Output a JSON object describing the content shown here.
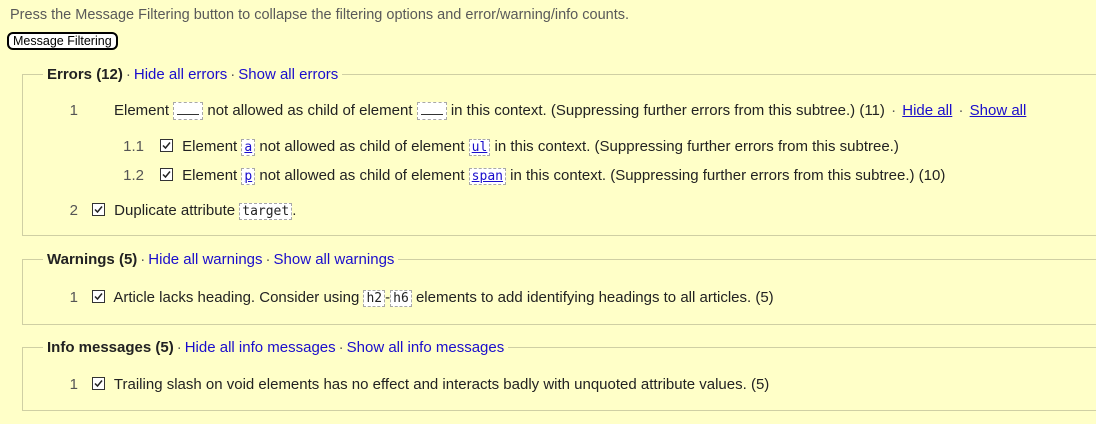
{
  "instructions": "Press the Message Filtering button to collapse the filtering options and error/warning/info counts.",
  "toggle_button": "Message Filtering",
  "errors": {
    "title": "Errors (12)",
    "sep": "·",
    "hide_all": "Hide all errors",
    "show_all": "Show all errors",
    "items": [
      {
        "num": "1",
        "t1": "Element",
        "t2": "not allowed as child of element",
        "t3": "in this context. (Suppressing further errors from this subtree.) (11)",
        "hide": "Hide all",
        "show": "Show all",
        "children": [
          {
            "num": "1.1",
            "t1": "Element",
            "el": "a",
            "t2": "not allowed as child of element",
            "parent": "ul",
            "t3": "in this context. (Suppressing further errors from this subtree.)"
          },
          {
            "num": "1.2",
            "t1": "Element",
            "el": "p",
            "t2": "not allowed as child of element",
            "parent": "span",
            "t3": "in this context. (Suppressing further errors from this subtree.) (10)"
          }
        ]
      },
      {
        "num": "2",
        "t1": "Duplicate attribute",
        "attr": "target",
        "t2": "."
      }
    ]
  },
  "warnings": {
    "title": "Warnings (5)",
    "hide_all": "Hide all warnings",
    "show_all": "Show all warnings",
    "items": [
      {
        "num": "1",
        "t1": "Article lacks heading. Consider using",
        "c1": "h2",
        "dash": "-",
        "c2": "h6",
        "t2": "elements to add identifying headings to all articles. (5)"
      }
    ]
  },
  "info": {
    "title": "Info messages (5)",
    "hide_all": "Hide all info messages",
    "show_all": "Show all info messages",
    "items": [
      {
        "num": "1",
        "text": "Trailing slash on void elements has no effect and interacts badly with unquoted attribute values. (5)"
      }
    ]
  },
  "colors": {
    "background": "#ffffc8",
    "link": "#1a0dcc",
    "border": "#cfcfa4"
  }
}
